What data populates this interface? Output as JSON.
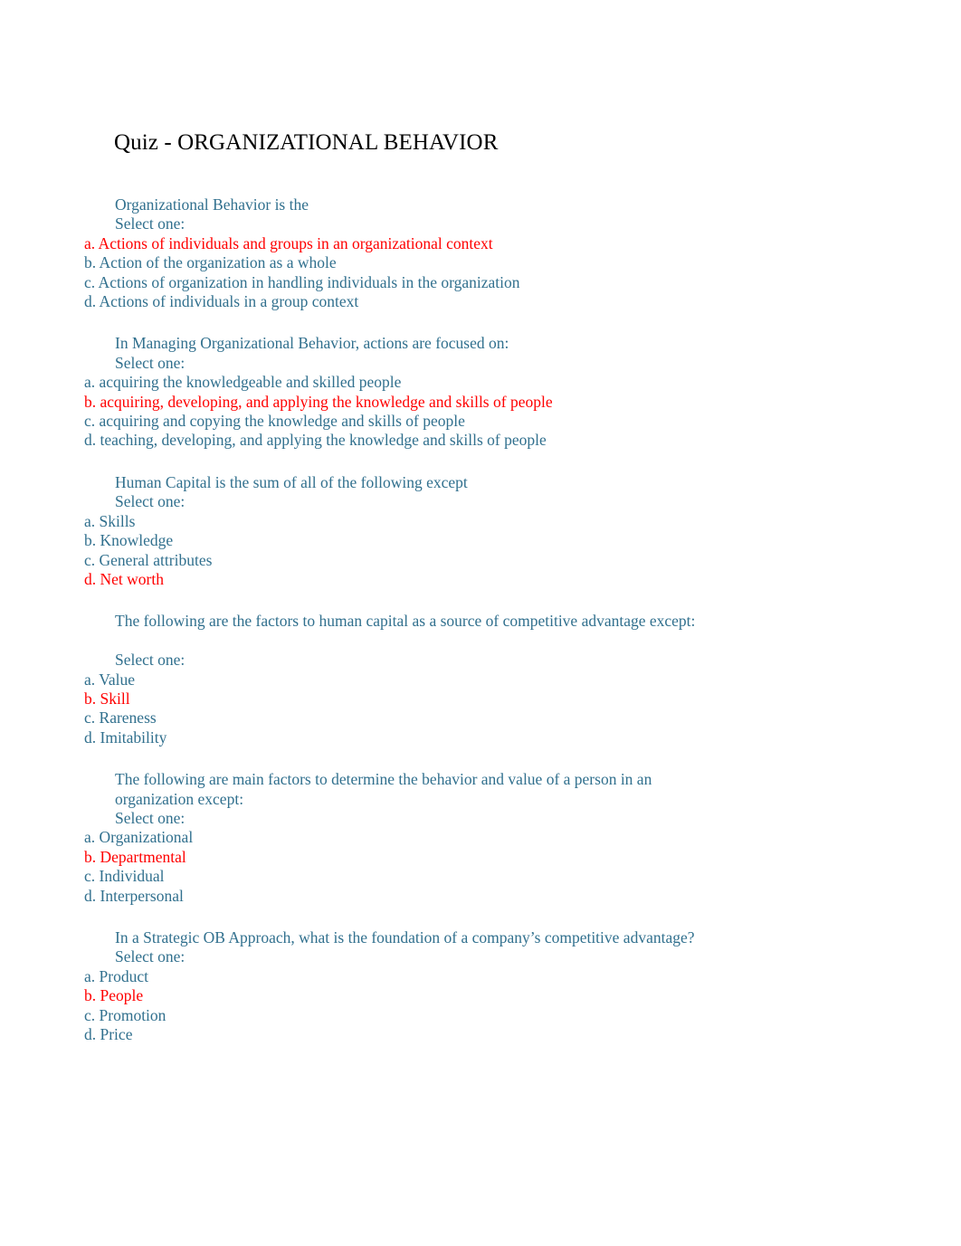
{
  "document": {
    "title": "Quiz - ORGANIZATIONAL BEHAVIOR",
    "select_one_label": "Select one:",
    "colors": {
      "title": "#000000",
      "body_text": "#31708E",
      "correct_answer": "#FF0000",
      "background": "#FFFFFF"
    }
  },
  "questions": [
    {
      "id": "q1",
      "stem": "Organizational Behavior is the",
      "stem_extra_blank_line": false,
      "select_one": "Select one:",
      "options": [
        {
          "label": "a. Actions of individuals and groups in an organizational context",
          "correct": true
        },
        {
          "label": "b. Action of the organization as a whole",
          "correct": false
        },
        {
          "label": "c. Actions of organization in handling individuals in the organization",
          "correct": false
        },
        {
          "label": "d. Actions of individuals in a group context",
          "correct": false
        }
      ]
    },
    {
      "id": "q2",
      "stem": "In Managing Organizational Behavior, actions are focused on:",
      "stem_extra_blank_line": false,
      "select_one": "Select one:",
      "options": [
        {
          "label": "a. acquiring the knowledgeable and skilled people",
          "correct": false
        },
        {
          "label": "b. acquiring, developing, and applying the knowledge and skills of people",
          "correct": true
        },
        {
          "label": "c. acquiring and copying the knowledge and skills of people",
          "correct": false
        },
        {
          "label": "d. teaching, developing, and applying the knowledge and skills of people",
          "correct": false
        }
      ]
    },
    {
      "id": "q3",
      "stem": "Human Capital is the sum of all of the following except",
      "stem_extra_blank_line": false,
      "select_one": "Select one:",
      "options": [
        {
          "label": "a. Skills",
          "correct": false
        },
        {
          "label": "b. Knowledge",
          "correct": false
        },
        {
          "label": "c. General attributes",
          "correct": false
        },
        {
          "label": "d. Net worth",
          "correct": true
        }
      ]
    },
    {
      "id": "q4",
      "stem": "The following are the factors to human capital as a source of competitive advantage except:",
      "stem_extra_blank_line": true,
      "select_one": "Select one:",
      "options": [
        {
          "label": "a. Value",
          "correct": false
        },
        {
          "label": "b. Skill",
          "correct": true
        },
        {
          "label": "c. Rareness",
          "correct": false
        },
        {
          "label": "d. Imitability",
          "correct": false
        }
      ]
    },
    {
      "id": "q5",
      "stem": "The following are main factors to determine the behavior and value of a person in an organization except:",
      "stem_extra_blank_line": false,
      "select_one": "Select one:",
      "options": [
        {
          "label": "a. Organizational",
          "correct": false
        },
        {
          "label": "b. Departmental",
          "correct": true
        },
        {
          "label": "c. Individual",
          "correct": false
        },
        {
          "label": "d. Interpersonal",
          "correct": false
        }
      ]
    },
    {
      "id": "q6",
      "stem": "In a Strategic OB Approach, what is the foundation of a company’s competitive advantage?",
      "stem_extra_blank_line": false,
      "select_one": "Select one:",
      "options": [
        {
          "label": "a. Product",
          "correct": false
        },
        {
          "label": "b. People",
          "correct": true
        },
        {
          "label": "c. Promotion",
          "correct": false
        },
        {
          "label": "d. Price",
          "correct": false
        }
      ]
    }
  ]
}
